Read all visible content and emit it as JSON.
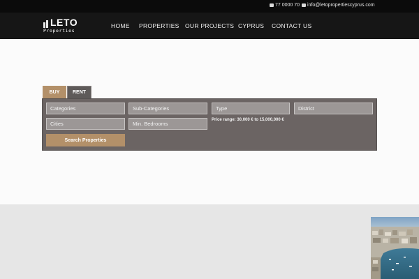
{
  "topbar": {
    "phone": "77 0000 70",
    "email": "info@letopropertiescyprus.com"
  },
  "logo": {
    "word": "LETO",
    "sub": "Properties"
  },
  "nav": {
    "items": [
      "HOME",
      "PROPERTIES",
      "OUR PROJECTS",
      "CYPRUS",
      "CONTACT US"
    ]
  },
  "search": {
    "tabs": [
      "BUY",
      "RENT"
    ],
    "active_tab": "BUY",
    "fields": {
      "categories": "Categories",
      "sub_categories": "Sub-Categories",
      "type": "Type",
      "district": "District",
      "cities": "Cities",
      "min_bedrooms": "Min. Bedrooms"
    },
    "price_range": "Price range: 30,000 € to 15,000,000 €",
    "button": "Search Properties"
  },
  "colors": {
    "accent": "#b39069",
    "panel": "#6b6463",
    "nav_bg": "#161616",
    "topbar_bg": "#0b0b0b"
  }
}
